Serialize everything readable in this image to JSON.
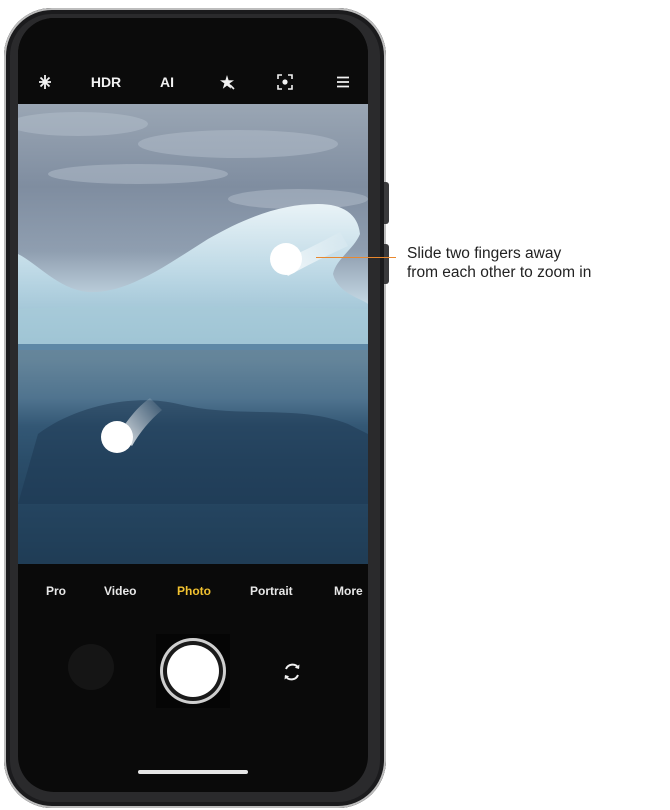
{
  "topbar": {
    "items": [
      {
        "name": "flash-icon",
        "label": ""
      },
      {
        "name": "hdr",
        "label": "HDR"
      },
      {
        "name": "ai",
        "label": "AI"
      },
      {
        "name": "beauty-icon",
        "label": ""
      },
      {
        "name": "focus-icon",
        "label": ""
      },
      {
        "name": "menu-icon",
        "label": ""
      }
    ]
  },
  "modes": [
    "Pro",
    "Video",
    "Photo",
    "Portrait",
    "More"
  ],
  "active_mode": "Photo",
  "callout": {
    "line1": "Slide two fingers away",
    "line2": "from each other to zoom in"
  },
  "colors": {
    "active_mode": "#f2c230",
    "callout_line": "#e8882f"
  }
}
